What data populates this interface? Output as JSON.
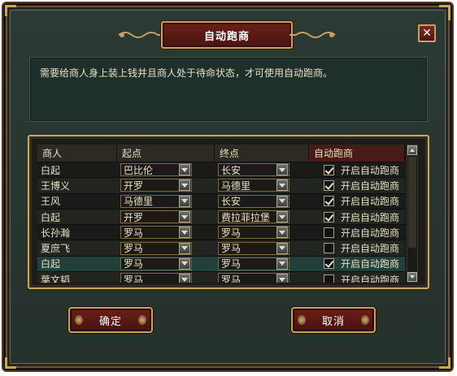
{
  "dialog": {
    "title": "自动跑商",
    "close_glyph": "✕",
    "notice": "需要给商人身上装上钱并且商人处于待命状态，才可使用自动跑商。"
  },
  "table": {
    "headers": {
      "merchant": "商人",
      "start": "起点",
      "end": "终点",
      "auto": "自动跑商"
    },
    "rows": [
      {
        "merchant": "白起",
        "start": "巴比伦",
        "end": "长安",
        "auto_checked": true,
        "auto_label": "开启自动跑商"
      },
      {
        "merchant": "王博义",
        "start": "开罗",
        "end": "马德里",
        "auto_checked": true,
        "auto_label": "开启自动跑商"
      },
      {
        "merchant": "王风",
        "start": "马德里",
        "end": "长安",
        "auto_checked": true,
        "auto_label": "开启自动跑商"
      },
      {
        "merchant": "白起",
        "start": "开罗",
        "end": "费拉菲拉堡",
        "auto_checked": true,
        "auto_label": "开启自动跑商"
      },
      {
        "merchant": "长孙瀚",
        "start": "罗马",
        "end": "罗马",
        "auto_checked": false,
        "auto_label": "开启自动跑商"
      },
      {
        "merchant": "夏庶飞",
        "start": "罗马",
        "end": "罗马",
        "auto_checked": false,
        "auto_label": "开启自动跑商"
      },
      {
        "merchant": "白起",
        "start": "罗马",
        "end": "罗马",
        "auto_checked": true,
        "auto_label": "开启自动跑商"
      },
      {
        "merchant": "葉文韬",
        "start": "罗马",
        "end": "罗马",
        "auto_checked": false,
        "auto_label": "开启自动跑商"
      }
    ],
    "selected_row": 6
  },
  "buttons": {
    "ok_label": "确定",
    "cancel_label": "取消"
  },
  "icons": {
    "dropdown": "chevron-down-icon",
    "scroll_up": "arrow-up-icon",
    "scroll_down": "arrow-down-icon",
    "close": "close-icon"
  }
}
